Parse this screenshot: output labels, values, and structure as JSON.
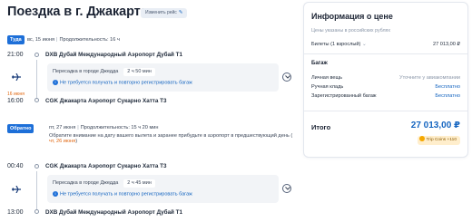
{
  "page": {
    "title": "Поездка в г. Джакарта",
    "edit_label": "Изменить рейс"
  },
  "outbound": {
    "tag": "Туда",
    "date": "вс, 15 июня",
    "duration_label": "Продолжительность: 16 ч",
    "dep_time": "21:00",
    "dep_text": "DXB Дубай Международный Аэропорт Дубай Т1",
    "transfer_city": "Пересадка в городе Джедда",
    "transfer_duration": "2 ч 50 мин",
    "transfer_note": "Не требуется получать и повторно регистрировать багаж",
    "arr_date_note": "16 июня",
    "arr_time": "16:00",
    "arr_text": "CGK Джакарта Аэропорт Сукарно Хатта Т3"
  },
  "inbound": {
    "tag": "Обратно",
    "date": "пт, 27 июня",
    "duration_label": "Продолжительность: 15 ч 20 мин",
    "notice": "Обратите внимание на дату вашего вылета и заранее прибудьте в аэропорт в предшествующий день (",
    "notice_date": "чт, 26 июня",
    "notice_end": ")",
    "dep_time": "00:40",
    "dep_text": "CGK Джакарта Аэропорт Сукарно Хатта Т3",
    "transfer_city": "Пересадка в городе Джедда",
    "transfer_duration": "2 ч 45 мин",
    "transfer_note": "Не требуется получать и повторно регистрировать багаж",
    "arr_time": "13:00",
    "arr_text": "DXB Дубай Международный Аэропорт Дубай Т1"
  },
  "price": {
    "heading": "Информация о цене",
    "subtitle": "Цены указаны в российских рублях",
    "tickets_label": "Билеты (1 взрослый)",
    "tickets_value": "27 013,00 ₽",
    "baggage_heading": "Багаж",
    "baggage": [
      {
        "label": "Личная вещь",
        "value": "Уточните у авиакомпании"
      },
      {
        "label": "Ручная кладь",
        "value": "Бесплатно"
      },
      {
        "label": "Зарегистрированный багаж",
        "value": "Бесплатно"
      }
    ],
    "total_label": "Итого",
    "total_value": "27 013,00 ₽",
    "bonus": "Trip Coins +110"
  },
  "colors": {
    "accent": "#1d6fd8",
    "link": "#1565c0",
    "warning": "#e0640c"
  },
  "icons": [
    "pencil-icon",
    "plane-icon",
    "info-icon",
    "chevron-down-icon",
    "coin-icon"
  ]
}
